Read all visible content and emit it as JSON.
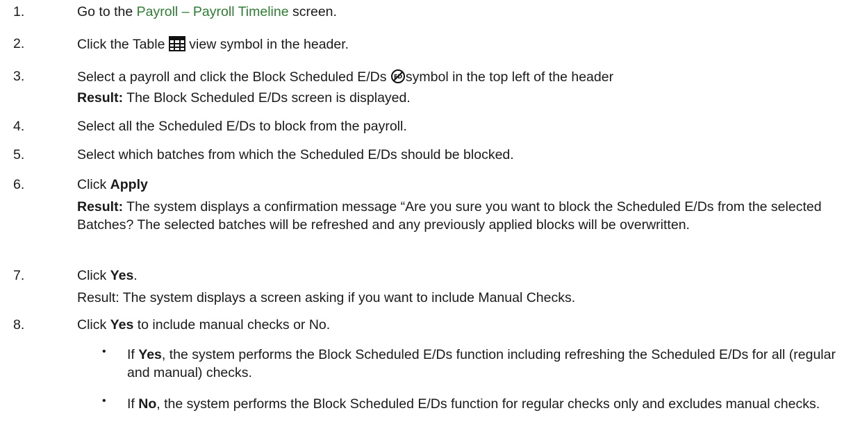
{
  "steps": [
    {
      "num": "1.",
      "pre": "Go to the ",
      "link": "Payroll – Payroll Timeline",
      "post": " screen."
    },
    {
      "num": "2.",
      "pre": " Click the Table ",
      "icon": "table-grid-icon",
      "post": " view symbol in the header."
    },
    {
      "num": "3.",
      "pre": "Select a payroll and click the Block Scheduled E/Ds ",
      "icon": "block-ed-icon",
      "post": "symbol in the top left of the header",
      "result_label": "Result:",
      "result_text": " The Block Scheduled E/Ds screen is displayed."
    },
    {
      "num": "4.",
      "text": "Select all the Scheduled E/Ds to block from the payroll."
    },
    {
      "num": "5.",
      "text": "Select which batches from which the Scheduled E/Ds should be blocked."
    },
    {
      "num": "6.",
      "pre": "Click ",
      "bold": "Apply",
      "result_label": "Result:",
      "result_text": " The system displays a confirmation message “Are you sure you want to block the Scheduled E/Ds from the selected Batches? The selected batches will be refreshed and any previously applied blocks will be overwritten."
    },
    {
      "num": "7.",
      "pre": "Click ",
      "bold": "Yes",
      "post": ".",
      "result_plain": "Result: The system displays a screen asking if you want to include Manual Checks."
    },
    {
      "num": "8.",
      "pre": "Click ",
      "bold": "Yes",
      "post": " to include manual checks or No."
    }
  ],
  "bullets": [
    {
      "pre": "If ",
      "bold": "Yes",
      "post": ", the system performs the Block Scheduled E/Ds function including refreshing the Scheduled E/Ds for all (regular and manual) checks."
    },
    {
      "pre": "If ",
      "bold": "No",
      "post": ", the system performs the Block Scheduled E/Ds function for regular checks only and excludes manual checks."
    }
  ],
  "bullet_char": "•",
  "colors": {
    "link": "#2e7d32",
    "text": "#1a1a1a"
  }
}
